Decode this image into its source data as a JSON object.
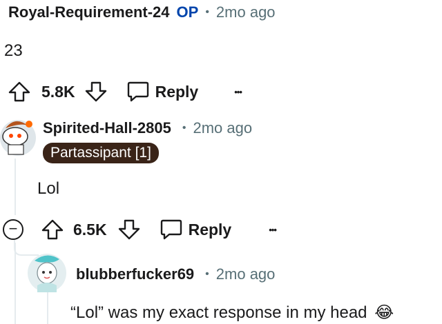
{
  "comment_op": {
    "username": "Royal-Requirement-24",
    "op_badge": "OP",
    "separator": "•",
    "time": "2mo ago",
    "body": "23",
    "score": "5.8K",
    "reply_label": "Reply",
    "more_label": "•••"
  },
  "comment_reply1": {
    "username": "Spirited-Hall-2805",
    "separator": "•",
    "time": "2mo ago",
    "flair": "Partassipant [1]",
    "body": "Lol",
    "score": "6.5K",
    "reply_label": "Reply",
    "more_label": "•••",
    "collapse_label": "−"
  },
  "comment_reply2": {
    "username": "blubberfucker69",
    "separator": "•",
    "time": "2mo ago",
    "body": "“Lol” was my exact response in my head",
    "emoji": "😂"
  },
  "colors": {
    "meta": "#576f76",
    "op": "#0045ac",
    "flair_bg": "#3a2418",
    "thread_line": "#e5ebee"
  }
}
